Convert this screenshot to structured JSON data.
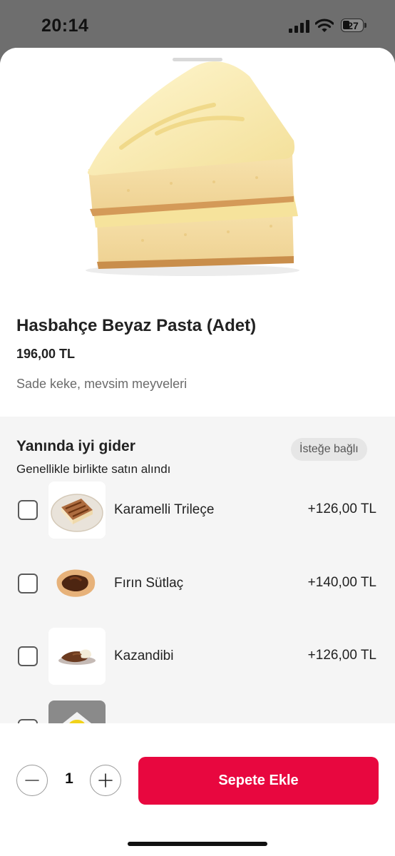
{
  "status_bar": {
    "time": "20:14",
    "battery": "27"
  },
  "product": {
    "title": "Hasbahçe Beyaz Pasta (Adet)",
    "price": "196,00 TL",
    "description": "Sade keke, mevsim meyveleri"
  },
  "section": {
    "title": "Yanında iyi gider",
    "subtitle": "Genellikle birlikte satın alındı",
    "badge": "İsteğe bağlı",
    "items": [
      {
        "name": "Karamelli Trileçe",
        "price": "+126,00 TL",
        "checked": false
      },
      {
        "name": "Fırın Sütlaç",
        "price": "+140,00 TL",
        "checked": false
      },
      {
        "name": "Kazandibi",
        "price": "+126,00 TL",
        "checked": false
      }
    ]
  },
  "cart": {
    "quantity": "1",
    "add_label": "Sepete Ekle"
  },
  "colors": {
    "accent": "#e8073f",
    "section_bg": "#f5f5f5",
    "overlay": "#6e6e6e"
  }
}
